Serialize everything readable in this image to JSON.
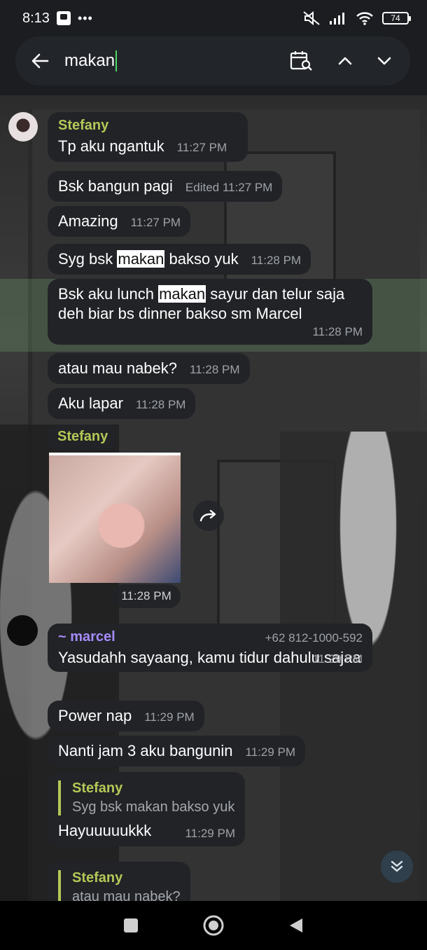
{
  "status_bar": {
    "time": "8:13",
    "dots": "•••",
    "battery": "74"
  },
  "search": {
    "query": "makan"
  },
  "messages": {
    "m1": {
      "sender": "Stefany",
      "text": "Tp aku ngantuk",
      "time": "11:27 PM"
    },
    "m2": {
      "text": "Bsk bangun pagi",
      "time": "Edited 11:27 PM"
    },
    "m3": {
      "text": "Amazing",
      "time": "11:27 PM"
    },
    "m4": {
      "before": "Syg bsk ",
      "match": "makan",
      "after": " bakso yuk",
      "time": "11:28 PM"
    },
    "m5": {
      "before": "Bsk aku lunch ",
      "match": "makan",
      "after": " sayur dan telur saja deh biar bs dinner bakso sm Marcel",
      "time": "11:28 PM"
    },
    "m6": {
      "text": "atau mau nabek?",
      "time": "11:28 PM"
    },
    "m7": {
      "text": "Aku lapar",
      "time": "11:28 PM"
    },
    "photo": {
      "sender": "Stefany",
      "time": "11:28 PM"
    },
    "m8": {
      "sender": "~ marcel",
      "phone": "+62 812-1000-592",
      "text": "Yasudahh sayaang, kamu tidur dahulu sajaa",
      "time": "11:29 PM"
    },
    "m9": {
      "text": "Power nap",
      "time": "11:29 PM"
    },
    "m10": {
      "text": "Nanti jam 3 aku bangunin",
      "time": "11:29 PM"
    },
    "m11": {
      "reply_name": "Stefany",
      "reply_text": "Syg bsk makan bakso yuk",
      "text": "Hayuuuuukkk",
      "time": "11:29 PM"
    },
    "m12": {
      "reply_name": "Stefany",
      "reply_text": "atau mau nabek?"
    }
  },
  "colors": {
    "accent_green": "#b3c856",
    "accent_purple": "#a78bfa",
    "cursor": "#4cd964"
  }
}
